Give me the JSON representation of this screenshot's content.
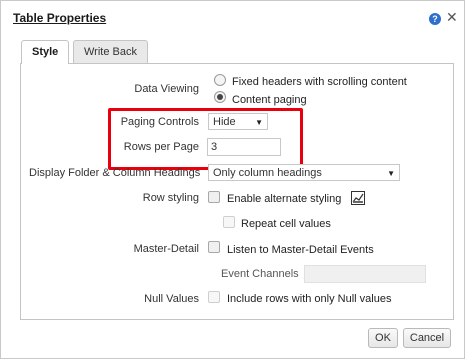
{
  "dialog": {
    "title": "Table Properties",
    "help_glyph": "?",
    "close_glyph": "✕",
    "tabs": [
      {
        "label": "Style",
        "selected": true
      },
      {
        "label": "Write Back",
        "selected": false
      }
    ]
  },
  "form": {
    "data_viewing": {
      "label": "Data Viewing",
      "options": [
        {
          "label": "Fixed headers with scrolling content",
          "selected": false
        },
        {
          "label": "Content paging",
          "selected": true
        }
      ]
    },
    "paging_controls": {
      "label": "Paging Controls",
      "value": "Hide",
      "arrow": "▼"
    },
    "rows_per_page": {
      "label": "Rows per Page",
      "value": "3"
    },
    "display_folder": {
      "label": "Display Folder & Column Headings",
      "value": "Only column headings",
      "arrow": "▼"
    },
    "row_styling": {
      "label": "Row styling",
      "option": "Enable alternate styling",
      "checked": false,
      "icon": "format-style-icon"
    },
    "repeat_cells": {
      "option": "Repeat cell values",
      "checked": false,
      "disabled": true
    },
    "master_detail": {
      "label": "Master-Detail",
      "option": "Listen to Master-Detail Events",
      "checked": false
    },
    "event_channels": {
      "label": "Event Channels",
      "value": ""
    },
    "null_values": {
      "label": "Null Values",
      "option": "Include rows with only Null values",
      "checked": false
    }
  },
  "footer": {
    "ok_label": "OK",
    "cancel_label": "Cancel"
  },
  "colors": {
    "highlight": "#e8000d",
    "help": "#2f6fcc"
  }
}
